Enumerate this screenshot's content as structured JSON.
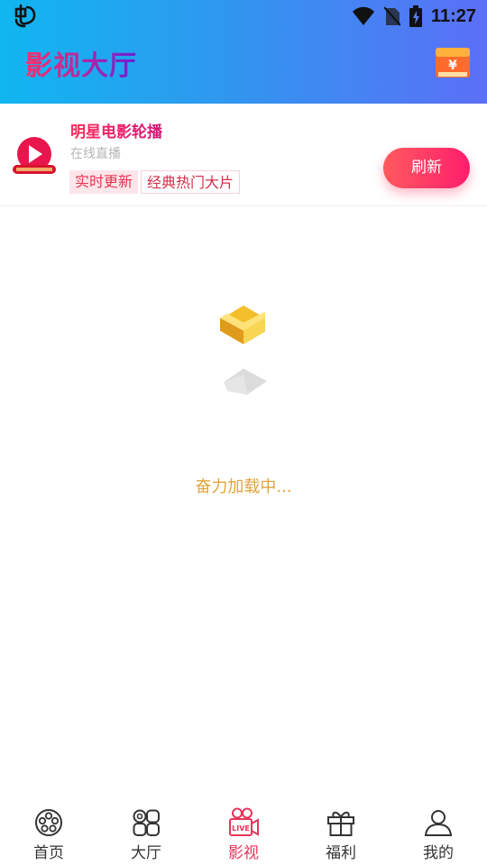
{
  "status_bar": {
    "time": "11:27"
  },
  "header": {
    "title": "影视大厅",
    "wallet_icon": "yuan-wallet-icon",
    "wallet_symbol": "¥"
  },
  "card": {
    "title": "明星电影轮播",
    "subtitle": "在线直播",
    "tags": [
      "实时更新",
      "经典热门大片"
    ],
    "refresh_label": "刷新"
  },
  "loading": {
    "text": "奋力加载中..."
  },
  "bottom_nav": {
    "items": [
      {
        "label": "首页",
        "icon": "film-reel-icon"
      },
      {
        "label": "大厅",
        "icon": "grid-hall-icon"
      },
      {
        "label": "影视",
        "icon": "live-camera-icon",
        "active": true
      },
      {
        "label": "福利",
        "icon": "gift-icon"
      },
      {
        "label": "我的",
        "icon": "user-icon"
      }
    ]
  },
  "colors": {
    "accent": "#e8345a",
    "header_start": "#10b6f0",
    "header_end": "#5b6ff7",
    "loading_text": "#e2a43a"
  }
}
